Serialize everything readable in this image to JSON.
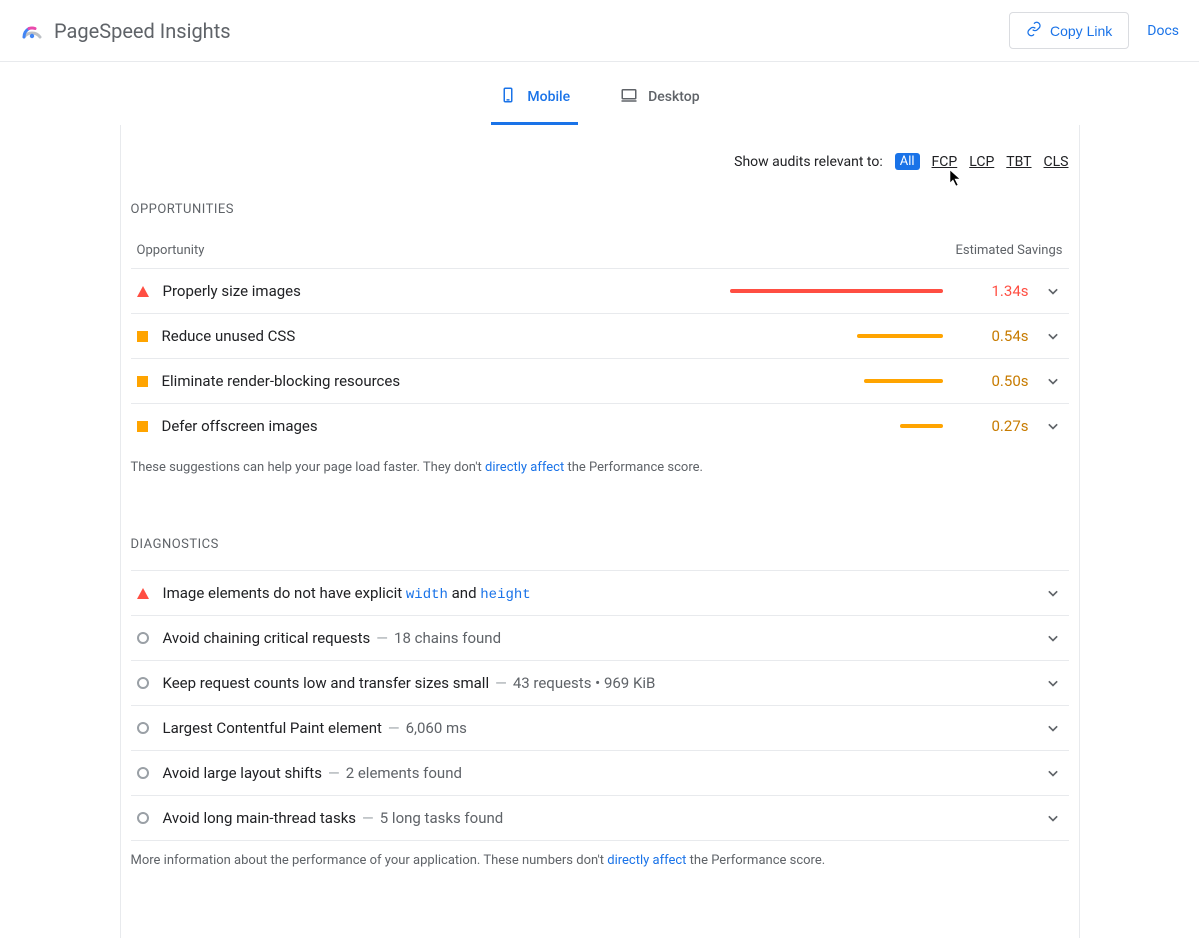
{
  "header": {
    "app_name": "PageSpeed Insights",
    "copy_link": "Copy Link",
    "docs": "Docs"
  },
  "tabs": {
    "mobile": "Mobile",
    "desktop": "Desktop"
  },
  "filter": {
    "label": "Show audits relevant to:",
    "items": [
      "All",
      "FCP",
      "LCP",
      "TBT",
      "CLS"
    ]
  },
  "opportunities": {
    "heading": "OPPORTUNITIES",
    "col_opportunity": "Opportunity",
    "col_savings": "Estimated Savings",
    "rows": [
      {
        "severity": "red",
        "title": "Properly size images",
        "savings": "1.34s",
        "bar_pct": 100
      },
      {
        "severity": "orange",
        "title": "Reduce unused CSS",
        "savings": "0.54s",
        "bar_pct": 40
      },
      {
        "severity": "orange",
        "title": "Eliminate render-blocking resources",
        "savings": "0.50s",
        "bar_pct": 37
      },
      {
        "severity": "orange",
        "title": "Defer offscreen images",
        "savings": "0.27s",
        "bar_pct": 20
      }
    ],
    "footnote_pre": "These suggestions can help your page load faster. They don't ",
    "footnote_link": "directly affect",
    "footnote_post": " the Performance score."
  },
  "diagnostics": {
    "heading": "DIAGNOSTICS",
    "row0_pre": "Image elements do not have explicit ",
    "row0_c1": "width",
    "row0_mid": " and ",
    "row0_c2": "height",
    "rows": [
      {
        "title": "Avoid chaining critical requests",
        "detail": "18 chains found"
      },
      {
        "title": "Keep request counts low and transfer sizes small",
        "detail": "43 requests • 969 KiB"
      },
      {
        "title": "Largest Contentful Paint element",
        "detail": "6,060 ms"
      },
      {
        "title": "Avoid large layout shifts",
        "detail": "2 elements found"
      },
      {
        "title": "Avoid long main-thread tasks",
        "detail": "5 long tasks found"
      }
    ],
    "footnote_pre": "More information about the performance of your application. These numbers don't ",
    "footnote_link": "directly affect",
    "footnote_post": " the Performance score."
  }
}
